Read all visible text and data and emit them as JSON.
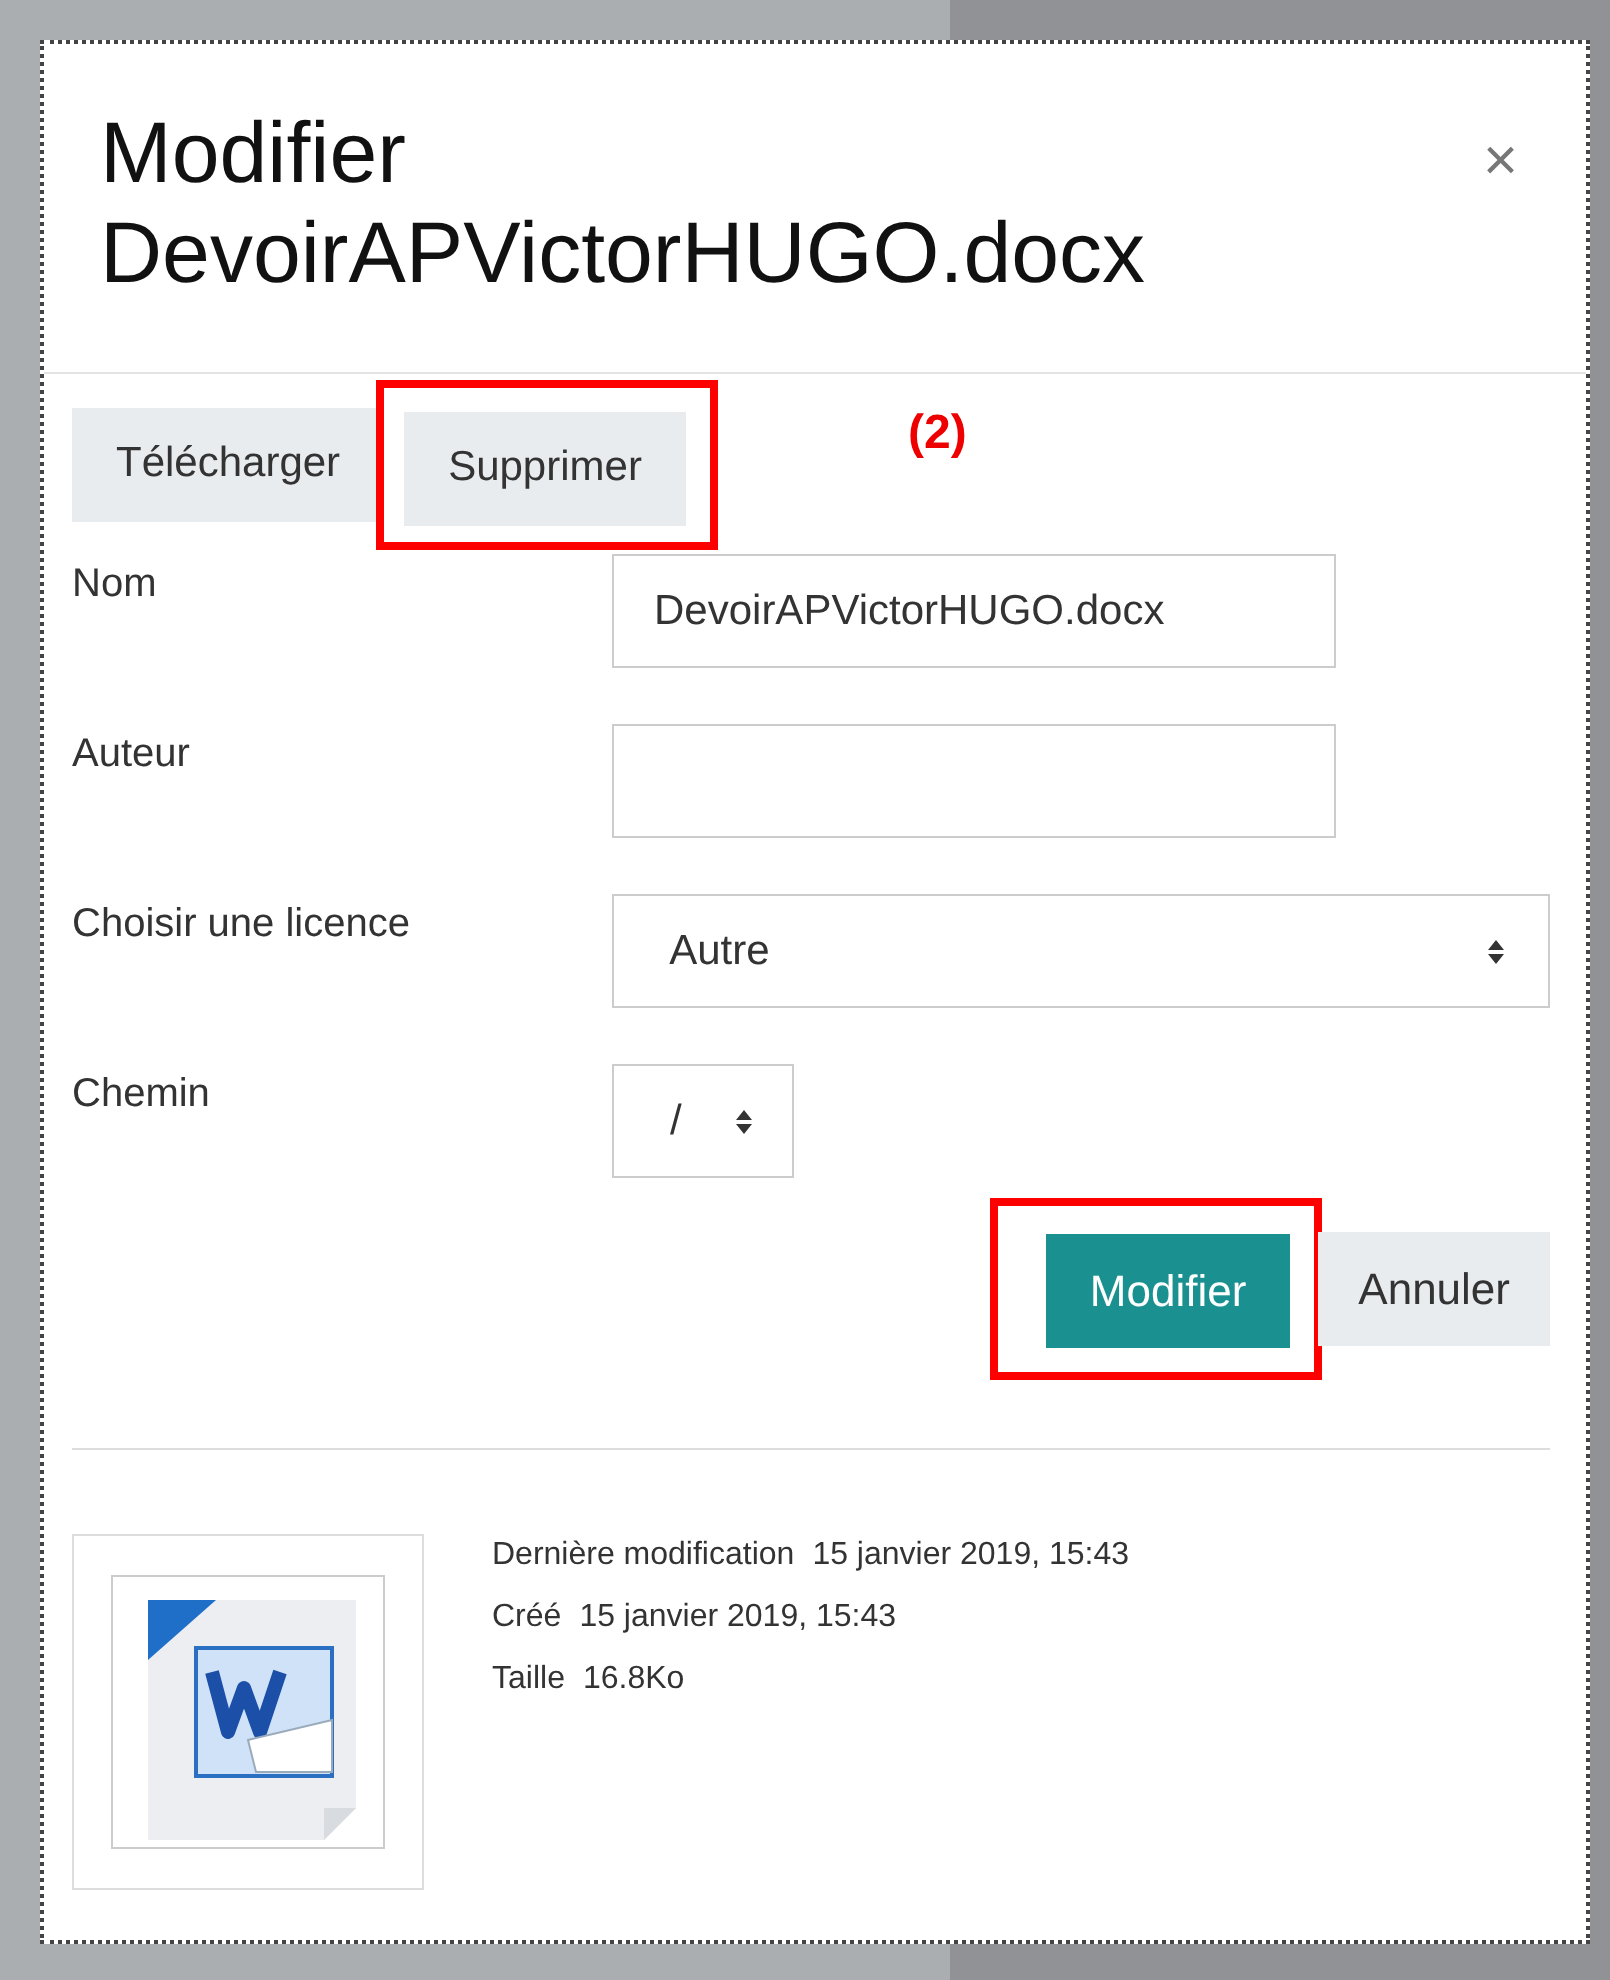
{
  "dialog": {
    "title": "Modifier DevoirAPVictorHUGO.docx",
    "close": "×"
  },
  "actions": [
    {
      "label": "Télécharger",
      "highlighted": false
    },
    {
      "label": "Supprimer",
      "highlighted": true
    }
  ],
  "annotation": "(2)",
  "fields": [
    {
      "kind": "text",
      "label": "Nom",
      "value": "DevoirAPVictorHUGO.docx"
    },
    {
      "kind": "text",
      "label": "Auteur"
    },
    {
      "kind": "select",
      "label": "Choisir une licence",
      "value": "Autre"
    },
    {
      "kind": "small-select",
      "label": "Chemin",
      "value": "/"
    }
  ],
  "buttons": [
    {
      "label": "Modifier",
      "primary": true,
      "highlighted": true
    },
    {
      "label": "Annuler",
      "primary": false,
      "highlighted": false
    }
  ],
  "details": [
    {
      "label": "Dernière modification",
      "value": "15 janvier 2019, 15:43"
    },
    {
      "label": "Créé",
      "value": "15 janvier 2019, 15:43"
    },
    {
      "label": "Taille",
      "value": "16.8Ko"
    }
  ]
}
